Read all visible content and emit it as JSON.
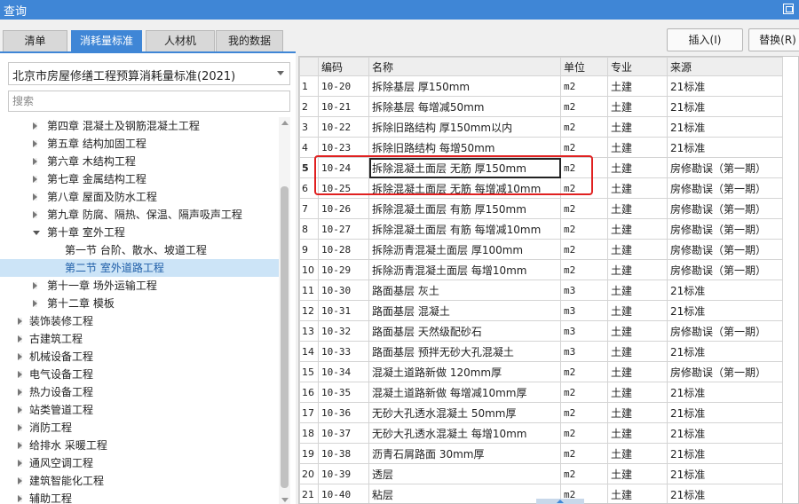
{
  "window": {
    "title": "查询"
  },
  "tabs": [
    {
      "label": "清单",
      "active": false
    },
    {
      "label": "消耗量标准",
      "active": true
    },
    {
      "label": "人材机",
      "active": false
    },
    {
      "label": "我的数据",
      "active": false
    }
  ],
  "standard_select": {
    "value": "北京市房屋修缮工程预算消耗量标准(2021)"
  },
  "search": {
    "placeholder": "搜索"
  },
  "tree": [
    {
      "label": "第四章 混凝土及钢筋混凝土工程",
      "level": 1,
      "expanded": false,
      "selected": false
    },
    {
      "label": "第五章 结构加固工程",
      "level": 1,
      "expanded": false,
      "selected": false
    },
    {
      "label": "第六章 木结构工程",
      "level": 1,
      "expanded": false,
      "selected": false
    },
    {
      "label": "第七章 金属结构工程",
      "level": 1,
      "expanded": false,
      "selected": false
    },
    {
      "label": "第八章 屋面及防水工程",
      "level": 1,
      "expanded": false,
      "selected": false
    },
    {
      "label": "第九章 防腐、隔热、保温、隔声吸声工程",
      "level": 1,
      "expanded": false,
      "selected": false
    },
    {
      "label": "第十章 室外工程",
      "level": 1,
      "expanded": true,
      "selected": false
    },
    {
      "label": "第一节 台阶、散水、坡道工程",
      "level": 2,
      "expanded": null,
      "selected": false
    },
    {
      "label": "第二节 室外道路工程",
      "level": 2,
      "expanded": null,
      "selected": true
    },
    {
      "label": "第十一章 场外运输工程",
      "level": 1,
      "expanded": false,
      "selected": false
    },
    {
      "label": "第十二章 模板",
      "level": 1,
      "expanded": false,
      "selected": false
    },
    {
      "label": "装饰装修工程",
      "level": 0,
      "expanded": false,
      "selected": false
    },
    {
      "label": "古建筑工程",
      "level": 0,
      "expanded": false,
      "selected": false
    },
    {
      "label": "机械设备工程",
      "level": 0,
      "expanded": false,
      "selected": false
    },
    {
      "label": "电气设备工程",
      "level": 0,
      "expanded": false,
      "selected": false
    },
    {
      "label": "热力设备工程",
      "level": 0,
      "expanded": false,
      "selected": false
    },
    {
      "label": "站类管道工程",
      "level": 0,
      "expanded": false,
      "selected": false
    },
    {
      "label": "消防工程",
      "level": 0,
      "expanded": false,
      "selected": false
    },
    {
      "label": "给排水 采暖工程",
      "level": 0,
      "expanded": false,
      "selected": false
    },
    {
      "label": "通风空调工程",
      "level": 0,
      "expanded": false,
      "selected": false
    },
    {
      "label": "建筑智能化工程",
      "level": 0,
      "expanded": false,
      "selected": false
    },
    {
      "label": "辅助工程",
      "level": 0,
      "expanded": false,
      "selected": false
    }
  ],
  "toolbar": {
    "insert_label": "插入(I)",
    "replace_label": "替换(R)"
  },
  "table": {
    "columns": [
      "",
      "编码",
      "名称",
      "单位",
      "专业",
      "来源"
    ],
    "rows": [
      [
        "1",
        "10-20",
        "拆除基层 厚150mm",
        "m2",
        "土建",
        "21标准"
      ],
      [
        "2",
        "10-21",
        "拆除基层 每增减50mm",
        "m2",
        "土建",
        "21标准"
      ],
      [
        "3",
        "10-22",
        "拆除旧路结构 厚150mm以内",
        "m2",
        "土建",
        "21标准"
      ],
      [
        "4",
        "10-23",
        "拆除旧路结构 每增50mm",
        "m2",
        "土建",
        "21标准"
      ],
      [
        "5",
        "10-24",
        "拆除混凝土面层 无筋 厚150mm",
        "m2",
        "土建",
        "房修勘误（第一期）"
      ],
      [
        "6",
        "10-25",
        "拆除混凝土面层 无筋 每增减10mm",
        "m2",
        "土建",
        "房修勘误（第一期）"
      ],
      [
        "7",
        "10-26",
        "拆除混凝土面层 有筋 厚150mm",
        "m2",
        "土建",
        "房修勘误（第一期）"
      ],
      [
        "8",
        "10-27",
        "拆除混凝土面层 有筋 每增减10mm",
        "m2",
        "土建",
        "房修勘误（第一期）"
      ],
      [
        "9",
        "10-28",
        "拆除沥青混凝土面层 厚100mm",
        "m2",
        "土建",
        "房修勘误（第一期）"
      ],
      [
        "10",
        "10-29",
        "拆除沥青混凝土面层 每增10mm",
        "m2",
        "土建",
        "房修勘误（第一期）"
      ],
      [
        "11",
        "10-30",
        "路面基层 灰土",
        "m3",
        "土建",
        "21标准"
      ],
      [
        "12",
        "10-31",
        "路面基层 混凝土",
        "m3",
        "土建",
        "21标准"
      ],
      [
        "13",
        "10-32",
        "路面基层 天然级配砂石",
        "m3",
        "土建",
        "房修勘误（第一期）"
      ],
      [
        "14",
        "10-33",
        "路面基层 预拌无砂大孔混凝土",
        "m3",
        "土建",
        "21标准"
      ],
      [
        "15",
        "10-34",
        "混凝土道路新做 120mm厚",
        "m2",
        "土建",
        "房修勘误（第一期）"
      ],
      [
        "16",
        "10-35",
        "混凝土道路新做 每增减10mm厚",
        "m2",
        "土建",
        "21标准"
      ],
      [
        "17",
        "10-36",
        "无砂大孔透水混凝土 50mm厚",
        "m2",
        "土建",
        "21标准"
      ],
      [
        "18",
        "10-37",
        "无砂大孔透水混凝土 每增10mm",
        "m2",
        "土建",
        "21标准"
      ],
      [
        "19",
        "10-38",
        "沥青石屑路面 30mm厚",
        "m2",
        "土建",
        "21标准"
      ],
      [
        "20",
        "10-39",
        "透层",
        "m2",
        "土建",
        "21标准"
      ],
      [
        "21",
        "10-40",
        "粘层",
        "m2",
        "土建",
        "21标准"
      ]
    ],
    "selected_row": 5,
    "highlighted_rows": [
      5,
      6
    ]
  },
  "colors": {
    "accent": "#3f86d6",
    "highlight_border": "#e02020",
    "selected_tree_bg": "#cce4f7"
  }
}
